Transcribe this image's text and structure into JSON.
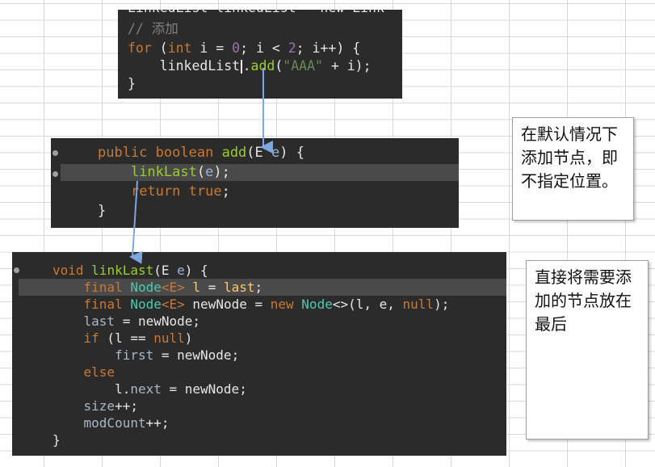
{
  "panel1": {
    "lines": [
      [
        [
          "tok",
          "LinkedList linkedList = new Link"
        ]
      ],
      [
        [
          "cm",
          "// 添加"
        ]
      ],
      [
        [
          "kw",
          "for"
        ],
        [
          "tok",
          " ("
        ],
        [
          "kw",
          "int"
        ],
        [
          "tok",
          " i = "
        ],
        [
          "num",
          "0"
        ],
        [
          "tok",
          "; i < "
        ],
        [
          "num",
          "2"
        ],
        [
          "tok",
          "; i++) {"
        ]
      ],
      [
        [
          "tok",
          "    linkedList"
        ],
        [
          "cursor",
          ""
        ],
        [
          "tok",
          "."
        ],
        [
          "fn",
          "add"
        ],
        [
          "tok",
          "("
        ],
        [
          "str",
          "\"AAA\""
        ],
        [
          "tok",
          " + i);"
        ]
      ],
      [
        [
          "tok",
          "}"
        ]
      ]
    ]
  },
  "panel2": {
    "lines": [
      [
        [
          "kw",
          "public"
        ],
        [
          "tok",
          " "
        ],
        [
          "kw",
          "boolean"
        ],
        [
          "tok",
          " "
        ],
        [
          "fn",
          "add"
        ],
        [
          "tok",
          "(E "
        ],
        [
          "tg",
          "e"
        ],
        [
          "tok",
          ") {"
        ]
      ],
      [
        [
          "tok",
          "    "
        ],
        [
          "fn",
          "linkLast"
        ],
        [
          "tok",
          "("
        ],
        [
          "tg",
          "e"
        ],
        [
          "tok",
          ");"
        ]
      ],
      [
        [
          "tok",
          "    "
        ],
        [
          "kw",
          "return"
        ],
        [
          "tok",
          " "
        ],
        [
          "kw",
          "true"
        ],
        [
          "tok",
          ";"
        ]
      ],
      [
        [
          "tok",
          "}"
        ]
      ]
    ]
  },
  "panel3": {
    "lines": [
      [
        [
          "kw",
          "void"
        ],
        [
          "tok",
          " "
        ],
        [
          "fn",
          "linkLast"
        ],
        [
          "tok",
          "(E "
        ],
        [
          "tg",
          "e"
        ],
        [
          "tok",
          ") {"
        ]
      ],
      [
        [
          "tok",
          "    "
        ],
        [
          "kw",
          "final"
        ],
        [
          "tok",
          " "
        ],
        [
          "ty",
          "Node"
        ],
        [
          "kw",
          "<E>"
        ],
        [
          "tok",
          " "
        ],
        [
          "vr",
          "l"
        ],
        [
          "tok",
          " = "
        ],
        [
          "vr",
          "last"
        ],
        [
          "tok",
          ";"
        ]
      ],
      [
        [
          "tok",
          "    "
        ],
        [
          "kw",
          "final"
        ],
        [
          "tok",
          " "
        ],
        [
          "ty",
          "Node"
        ],
        [
          "kw",
          "<E>"
        ],
        [
          "tok",
          " newNode = "
        ],
        [
          "kw",
          "new"
        ],
        [
          "tok",
          " "
        ],
        [
          "ty",
          "Node"
        ],
        [
          "tok",
          "<>(l, e, "
        ],
        [
          "kw",
          "null"
        ],
        [
          "tok",
          ");"
        ]
      ],
      [
        [
          "tok",
          "    "
        ],
        [
          "fd",
          "last"
        ],
        [
          "tok",
          " = newNode;"
        ]
      ],
      [
        [
          "tok",
          "    "
        ],
        [
          "kw",
          "if"
        ],
        [
          "tok",
          " (l == "
        ],
        [
          "kw",
          "null"
        ],
        [
          "tok",
          ")"
        ]
      ],
      [
        [
          "tok",
          "        "
        ],
        [
          "fd",
          "first"
        ],
        [
          "tok",
          " = newNode;"
        ]
      ],
      [
        [
          "tok",
          "    "
        ],
        [
          "kw",
          "else"
        ]
      ],
      [
        [
          "tok",
          "        l."
        ],
        [
          "fd",
          "next"
        ],
        [
          "tok",
          " = newNode;"
        ]
      ],
      [
        [
          "tok",
          "    "
        ],
        [
          "fd",
          "size"
        ],
        [
          "tok",
          "++;"
        ]
      ],
      [
        [
          "tok",
          "    "
        ],
        [
          "fd",
          "modCount"
        ],
        [
          "tok",
          "++;"
        ]
      ],
      [
        [
          "tok",
          "}"
        ]
      ]
    ]
  },
  "notes": {
    "note1": "在默认情况下添加节点，即不指定位置。",
    "note2": "直接将需要添加的节点放在最后"
  },
  "colors": {
    "editor_background": "#2b2b2b",
    "keyword": "#cc7832",
    "method": "#9acd32",
    "string": "#6a8759",
    "arrow": "#7da7e0"
  }
}
